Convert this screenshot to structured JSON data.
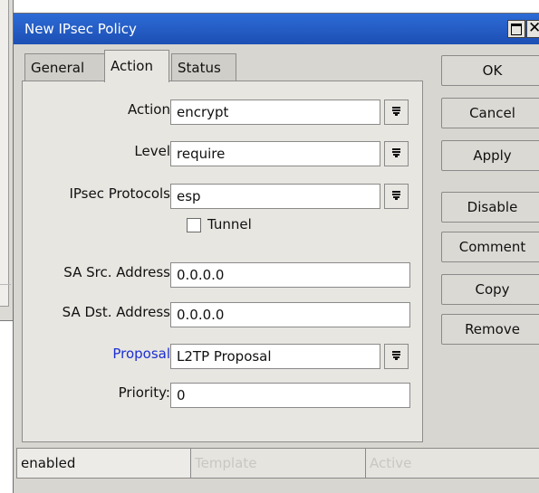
{
  "window": {
    "title": "New IPsec Policy"
  },
  "tabs": [
    {
      "label": "General"
    },
    {
      "label": "Action",
      "active": true
    },
    {
      "label": "Status"
    }
  ],
  "form": {
    "action": {
      "label": "Action",
      "value": "encrypt"
    },
    "level": {
      "label": "Level",
      "value": "require"
    },
    "ipsec_protocols": {
      "label": "IPsec Protocols",
      "value": "esp"
    },
    "tunnel": {
      "label": "Tunnel",
      "checked": false
    },
    "sa_src_address": {
      "label": "SA Src. Address",
      "value": "0.0.0.0"
    },
    "sa_dst_address": {
      "label": "SA Dst. Address",
      "value": "0.0.0.0"
    },
    "proposal": {
      "label": "Proposal",
      "value": "L2TP Proposal"
    },
    "priority": {
      "label": "Priority:",
      "value": "0"
    }
  },
  "buttons": {
    "ok": "OK",
    "cancel": "Cancel",
    "apply": "Apply",
    "disable": "Disable",
    "comment": "Comment",
    "copy": "Copy",
    "remove": "Remove"
  },
  "statusbar": {
    "state": "enabled",
    "template": "Template",
    "active": "Active"
  },
  "colors": {
    "titlebar": "#1f56be",
    "link_label": "#1b2fd0",
    "dialog_bg": "#d8d6d0"
  }
}
